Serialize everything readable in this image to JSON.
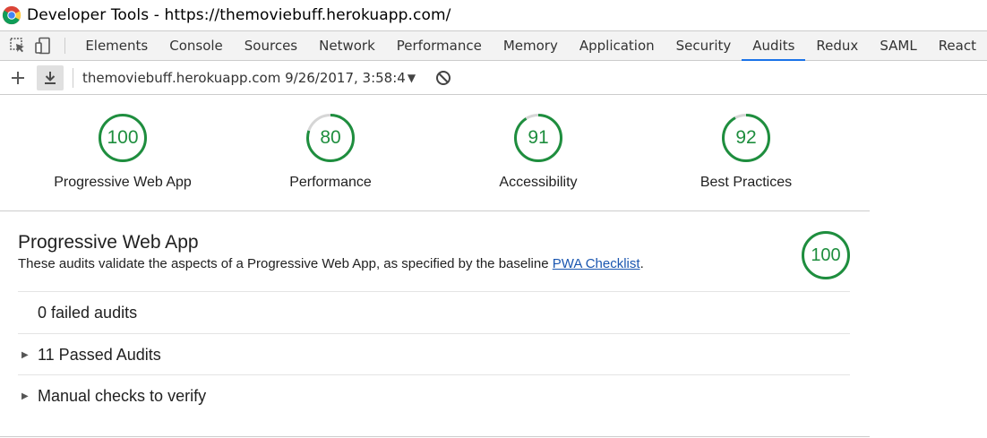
{
  "window": {
    "title": "Developer Tools - https://themoviebuff.herokuapp.com/"
  },
  "tabs": [
    {
      "label": "Elements"
    },
    {
      "label": "Console"
    },
    {
      "label": "Sources"
    },
    {
      "label": "Network"
    },
    {
      "label": "Performance"
    },
    {
      "label": "Memory"
    },
    {
      "label": "Application"
    },
    {
      "label": "Security"
    },
    {
      "label": "Audits",
      "active": true
    },
    {
      "label": "Redux"
    },
    {
      "label": "SAML"
    },
    {
      "label": "React"
    }
  ],
  "toolbar": {
    "report": "themoviebuff.herokuapp.com 9/26/2017, 3:58:4",
    "icons": [
      "plus-icon",
      "download-icon",
      "caret-down-icon",
      "block-icon"
    ]
  },
  "scores": [
    {
      "value": "100",
      "label": "Progressive Web App",
      "fraction": 1.0
    },
    {
      "value": "80",
      "label": "Performance",
      "fraction": 0.8
    },
    {
      "value": "91",
      "label": "Accessibility",
      "fraction": 0.91
    },
    {
      "value": "92",
      "label": "Best Practices",
      "fraction": 0.92
    }
  ],
  "category": {
    "title": "Progressive Web App",
    "description": "These audits validate the aspects of a Progressive Web App, as specified by the baseline",
    "link": "PWA Checklist",
    "description_end": ".",
    "score": "100",
    "score_fraction": 1.0,
    "rows": [
      {
        "label": "0 failed audits",
        "expandable": false
      },
      {
        "label": "11 Passed Audits",
        "expandable": true
      },
      {
        "label": "Manual checks to verify",
        "expandable": true
      }
    ]
  },
  "colors": {
    "pass": "#1e8e3e",
    "track": "#d6d6d6",
    "accent": "#1a73e8",
    "link": "#1a56b0"
  }
}
